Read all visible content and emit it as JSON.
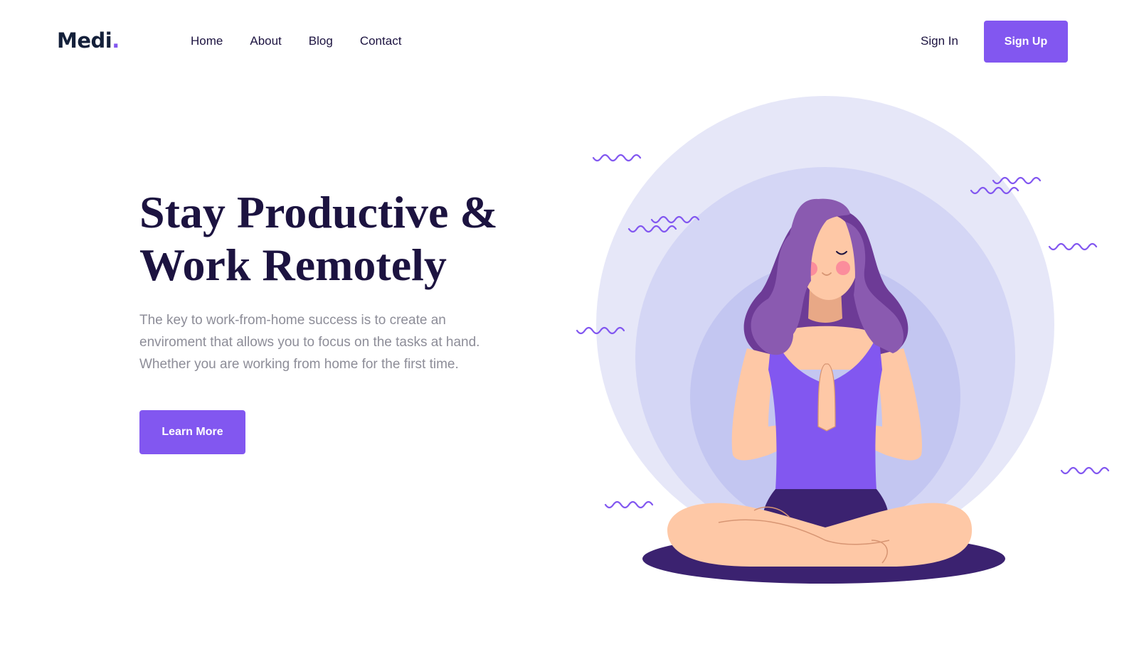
{
  "brand": {
    "name": "Medi",
    "dot": ".",
    "accent": "#8257f0"
  },
  "nav": {
    "links": [
      "Home",
      "About",
      "Blog",
      "Contact"
    ],
    "sign_in": "Sign In",
    "sign_up": "Sign Up"
  },
  "hero": {
    "title_line1": "Stay Productive &",
    "title_line2": "Work Remotely",
    "body_line1": "The key to work-from-home success is to create an",
    "body_line2": "enviroment that allows you to focus on the tasks at hand.",
    "body_line3": "Whether you are working from home for the first time.",
    "cta": "Learn More"
  },
  "colors": {
    "primary": "#8257f0",
    "heading": "#1c1340",
    "body_text": "#8d8d98",
    "circle_outer": "#e6e7f8",
    "circle_mid": "#d4d6f5",
    "circle_inner": "#c3c6f1",
    "mat": "#3b2270",
    "skin": "#fec8a6",
    "hair": "#8a5ab0",
    "top": "#8257f0"
  },
  "illustration": {
    "subject": "meditating-woman",
    "decoration": "wavy-lines"
  }
}
